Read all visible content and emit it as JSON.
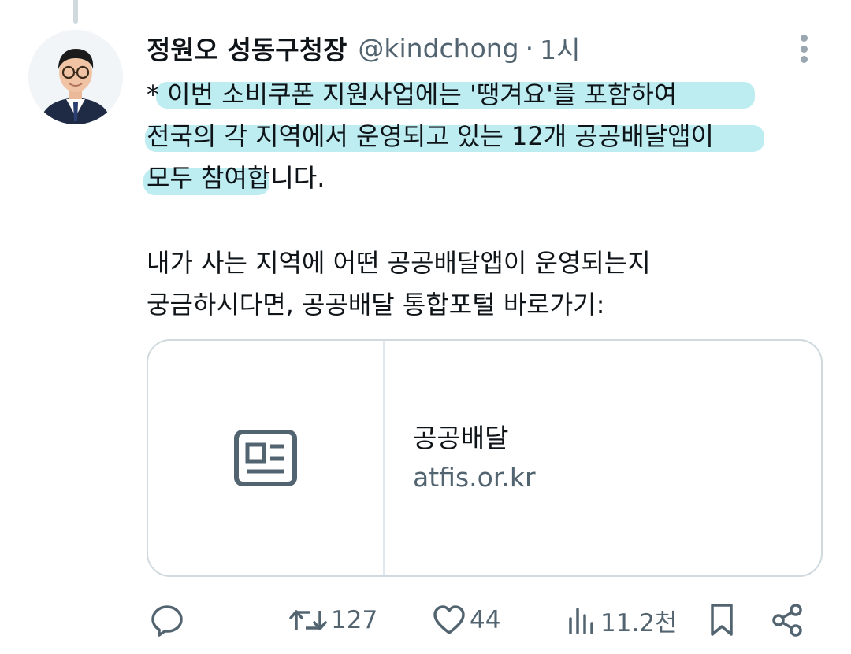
{
  "author": {
    "name": "정원오 성동구청장",
    "handle": "@kindchong",
    "separator": "·",
    "time": "1시"
  },
  "tweet": {
    "lines": [
      "* 이번 소비쿠폰 지원사업에는 '땡겨요'를 포함하여",
      "전국의 각 지역에서 운영되고 있는 12개 공공배달앱이",
      "모두 참여합니다.",
      "내가 사는 지역에 어떤 공공배달앱이 운영되는지",
      "궁금하시다면, 공공배달 통합포털 바로가기:"
    ]
  },
  "link_card": {
    "title": "공공배달",
    "domain": "atfis.or.kr",
    "thumbnail_icon": "article-icon"
  },
  "actions": {
    "reply": {
      "icon": "reply-icon",
      "count": ""
    },
    "retweet": {
      "icon": "retweet-icon",
      "count": "127"
    },
    "like": {
      "icon": "heart-icon",
      "count": "44"
    },
    "views": {
      "icon": "views-icon",
      "count": "11.2천"
    },
    "bookmark": {
      "icon": "bookmark-icon"
    },
    "share": {
      "icon": "share-icon"
    }
  },
  "colors": {
    "text": "#0f1419",
    "secondary": "#536471",
    "highlight": "#6ed6e1",
    "border": "#cfd9de"
  }
}
